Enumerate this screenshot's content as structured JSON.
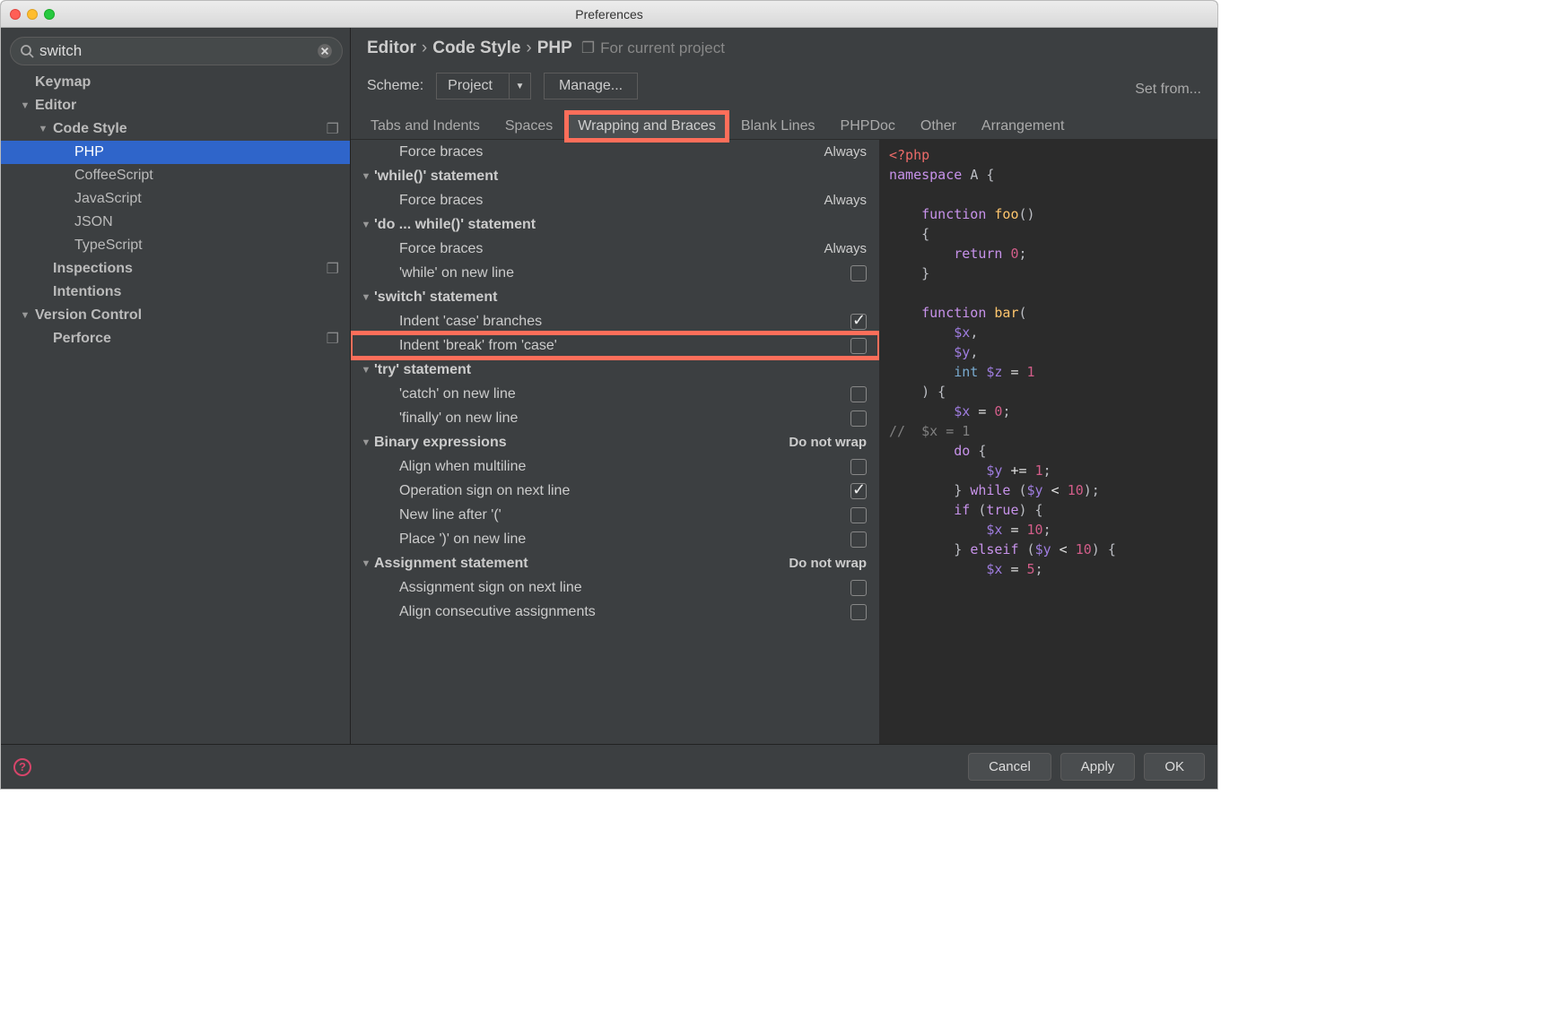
{
  "window": {
    "title": "Preferences"
  },
  "search": {
    "value": "switch"
  },
  "tree": {
    "keymap": "Keymap",
    "editor": "Editor",
    "codestyle": "Code Style",
    "php": "PHP",
    "coffeescript": "CoffeeScript",
    "javascript": "JavaScript",
    "json": "JSON",
    "typescript": "TypeScript",
    "inspections": "Inspections",
    "intentions": "Intentions",
    "vcs": "Version Control",
    "perforce": "Perforce"
  },
  "breadcrumb": {
    "a": "Editor",
    "b": "Code Style",
    "c": "PHP",
    "project_note": "For current project"
  },
  "scheme": {
    "label": "Scheme:",
    "value": "Project",
    "manage": "Manage...",
    "set_from": "Set from..."
  },
  "tabs": {
    "t0": "Tabs and Indents",
    "t1": "Spaces",
    "t2": "Wrapping and Braces",
    "t3": "Blank Lines",
    "t4": "PHPDoc",
    "t5": "Other",
    "t6": "Arrangement"
  },
  "settings": {
    "force_braces": "Force braces",
    "always": "Always",
    "while_stmt": "'while()' statement",
    "dowhile_stmt": "'do ... while()' statement",
    "while_newline": "'while' on new line",
    "switch_stmt": "'switch' statement",
    "indent_case": "Indent 'case' branches",
    "indent_break": "Indent 'break' from 'case'",
    "try_stmt": "'try' statement",
    "catch_newline": "'catch' on new line",
    "finally_newline": "'finally' on new line",
    "binary_expr": "Binary expressions",
    "dnw": "Do not wrap",
    "align_multiline": "Align when multiline",
    "op_sign_next": "Operation sign on next line",
    "newline_after_paren": "New line after '('",
    "place_paren_newline": "Place ')' on new line",
    "assignment_stmt": "Assignment statement",
    "assign_sign_next": "Assignment sign on next line",
    "align_consec_assign": "Align consecutive assignments"
  },
  "code": {
    "php_open": "<?php",
    "ns": "namespace",
    "ns_name": "A",
    "fn": "function",
    "foo": "foo",
    "bar": "bar",
    "ret": "return",
    "zero": "0",
    "x": "$x",
    "y": "$y",
    "z": "$z",
    "int": "int",
    "one": "1",
    "comment": "//  $x = 1",
    "do": "do",
    "while": "while",
    "ten": "10",
    "if": "if",
    "true": "true",
    "elseif": "elseif",
    "five": "5"
  },
  "footer": {
    "cancel": "Cancel",
    "apply": "Apply",
    "ok": "OK"
  }
}
